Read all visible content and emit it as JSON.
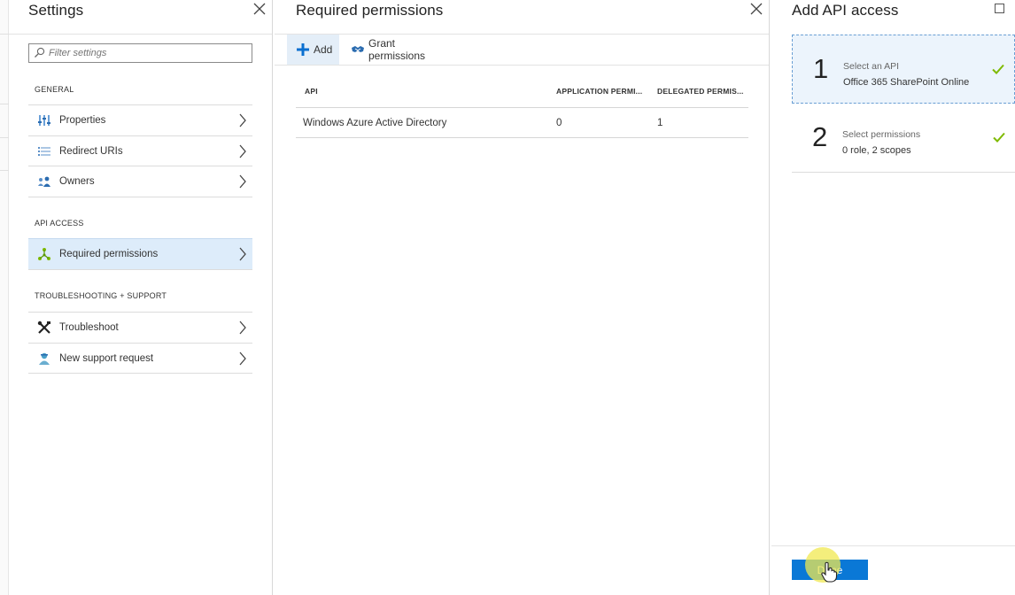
{
  "settings_blade": {
    "title": "Settings",
    "filter_placeholder": "Filter settings",
    "sections": [
      {
        "heading": "GENERAL",
        "items": [
          {
            "label": "Properties",
            "icon": "properties-icon"
          },
          {
            "label": "Redirect URIs",
            "icon": "list-icon"
          },
          {
            "label": "Owners",
            "icon": "owners-icon"
          }
        ]
      },
      {
        "heading": "API ACCESS",
        "items": [
          {
            "label": "Required permissions",
            "icon": "permissions-icon",
            "selected": true
          }
        ]
      },
      {
        "heading": "TROUBLESHOOTING + SUPPORT",
        "items": [
          {
            "label": "Troubleshoot",
            "icon": "tools-icon"
          },
          {
            "label": "New support request",
            "icon": "support-person-icon"
          }
        ]
      }
    ]
  },
  "permissions_blade": {
    "title": "Required permissions",
    "toolbar": {
      "add_label": "Add",
      "grant_label": "Grant permissions"
    },
    "table": {
      "columns": [
        "API",
        "APPLICATION PERMI...",
        "DELEGATED PERMIS..."
      ],
      "rows": [
        [
          "Windows Azure Active Directory",
          "0",
          "1"
        ]
      ]
    }
  },
  "api_blade": {
    "title": "Add API access",
    "steps": [
      {
        "number": "1",
        "title": "Select an API",
        "subtitle": "Office 365 SharePoint Online",
        "complete": true
      },
      {
        "number": "2",
        "title": "Select permissions",
        "subtitle": "0 role, 2 scopes",
        "complete": true
      }
    ],
    "done_label": "Done"
  },
  "colors": {
    "accent_blue": "#0a78d6",
    "selected_bg": "#ddecfa",
    "check_green": "#7fba00",
    "cursor_halo": "#f0e850"
  }
}
